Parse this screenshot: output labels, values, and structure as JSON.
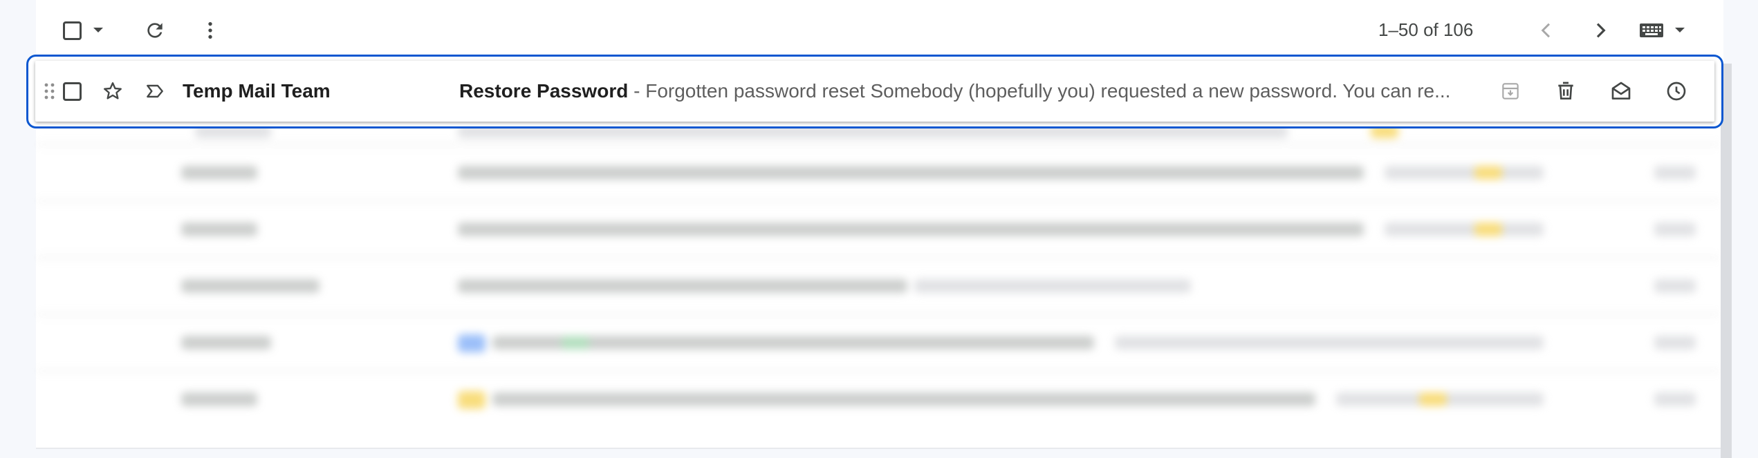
{
  "toolbar": {
    "pager": "1–50 of 106"
  },
  "active_row": {
    "sender": "Temp Mail Team",
    "subject": "Restore Password",
    "separator": " - ",
    "snippet": "Forgotten password reset Somebody (hopefully you) requested a new password. You can re..."
  },
  "icons": {
    "select_all": "checkbox-icon",
    "select_dropdown": "caret-down-icon",
    "refresh": "refresh-icon",
    "more": "more-vert-icon",
    "prev": "chevron-left-icon",
    "next": "chevron-right-icon",
    "input_tools": "keyboard-icon",
    "drag": "drag-handle-icon",
    "star": "star-icon",
    "important": "label-important-icon",
    "archive": "archive-icon",
    "delete": "trash-icon",
    "mark_read": "mail-open-icon",
    "snooze": "clock-icon"
  },
  "colors": {
    "accent": "#0b57d0",
    "icon": "#444746",
    "disabled_icon": "#a8a8a8",
    "background": "#f6f8fc"
  }
}
